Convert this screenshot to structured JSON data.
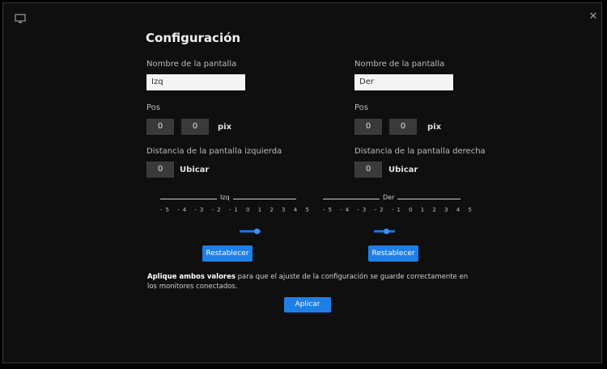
{
  "window": {
    "title": "Configuración",
    "close_glyph": "✕"
  },
  "left": {
    "name_label": "Nombre de la pantalla",
    "name_value": "Izq",
    "pos_label": "Pos",
    "pos_x": "0",
    "pos_y": "0",
    "pos_unit": "pix",
    "size_label": "Distancia de la pantalla izquierda",
    "size_value": "0",
    "size_unit": "Ubicar",
    "scale_label": "Izq",
    "ticks": "-5 -4 -3 -2 -1 0 1 2 3 4 5",
    "button_label": "Restablecer"
  },
  "right": {
    "name_label": "Nombre de la pantalla",
    "name_value": "Der",
    "pos_label": "Pos",
    "pos_x": "0",
    "pos_y": "0",
    "pos_unit": "pix",
    "size_label": "Distancia de la pantalla derecha",
    "size_value": "0",
    "size_unit": "Ubicar",
    "scale_label": "Der",
    "ticks": "-5 -4 -3 -2 -1 0 1 2 3 4 5",
    "button_label": "Restablecer"
  },
  "note_bold": "Aplique ambos valores",
  "note_text": "para que el ajuste de la configuración se guarde correctamente en los monitores conectados.",
  "apply_label": "Aplicar",
  "colors": {
    "accent": "#1f7fe8",
    "background": "#0f0f0f"
  }
}
